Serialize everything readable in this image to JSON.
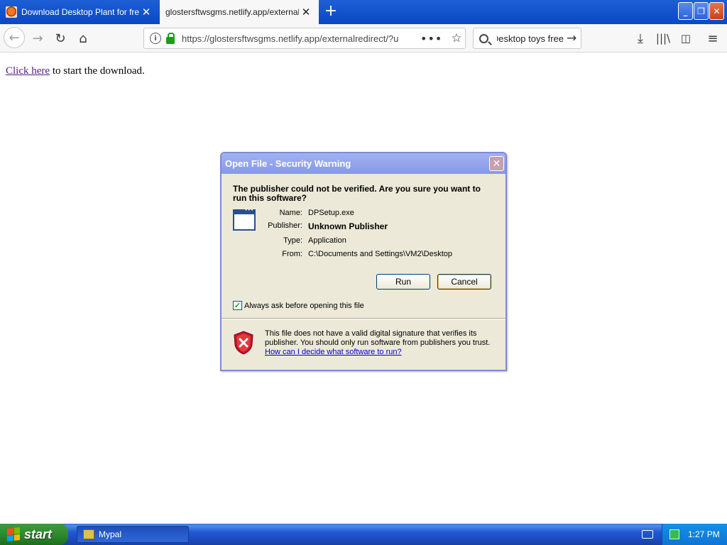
{
  "browser": {
    "tabs": [
      {
        "title": "Download Desktop Plant for free",
        "active": false
      },
      {
        "title": "glostersftwsgms.netlify.app/externalre",
        "active": true
      }
    ],
    "url": "https://glostersftwsgms.netlify.app/externalredirect/?u",
    "search_query": "Desktop toys free"
  },
  "page": {
    "link_text": "Click here",
    "text_after_link": " to start the download."
  },
  "dialog": {
    "title": "Open File - Security Warning",
    "heading": "The publisher could not be verified.  Are you sure you want to run this software?",
    "fields": [
      {
        "label": "Name:",
        "value": "DPSetup.exe"
      },
      {
        "label": "Publisher:",
        "value": "Unknown Publisher"
      },
      {
        "label": "Type:",
        "value": "Application"
      },
      {
        "label": "From:",
        "value": "C:\\Documents and Settings\\VM2\\Desktop"
      }
    ],
    "run_label": "Run",
    "cancel_label": "Cancel",
    "checkbox_label": "Always ask before opening this file",
    "checkbox_checked": true,
    "warning_text": "This file does not have a valid digital signature that verifies its publisher.  You should only run software from publishers you trust.",
    "warning_link": "How can I decide what software to run?"
  },
  "taskbar": {
    "start_label": "start",
    "task_item": "Mypal",
    "clock": "1:27 PM"
  }
}
